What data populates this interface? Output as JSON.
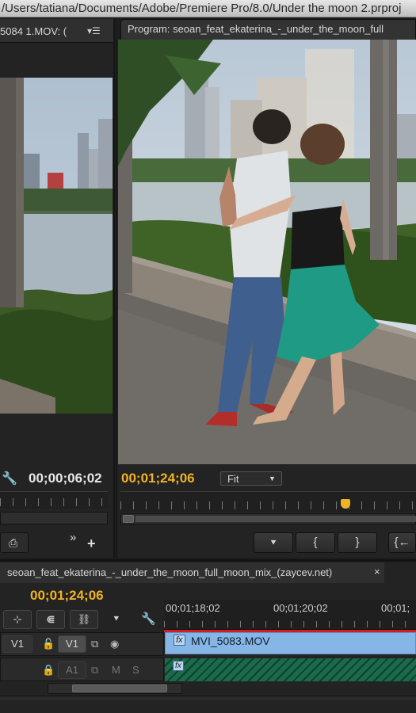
{
  "window": {
    "title": "/Users/tatiana/Documents/Adobe/Premiere Pro/8.0/Under the moon 2.prproj"
  },
  "source_monitor": {
    "tab_label": "5084 1.MOV: (",
    "menu_icon": "panel-menu-icon",
    "timecode": "00;00;06;02",
    "wrench_icon": "wrench-icon",
    "export_frame_icon": "export-frame-icon",
    "overflow_label": "»",
    "add_label": "+"
  },
  "program_monitor": {
    "tab_label": "Program: seoan_feat_ekaterina_-_under_the_moon_full",
    "timecode": "00;01;24;06",
    "fit_label": "Fit",
    "fit_arrow": "▼",
    "buttons": [
      {
        "name": "add-marker-button",
        "label": "⯆"
      },
      {
        "name": "mark-in-button",
        "label": "{"
      },
      {
        "name": "mark-out-button",
        "label": "}"
      },
      {
        "name": "go-to-in-button",
        "label": "{←"
      }
    ]
  },
  "timeline": {
    "sequence_tab": "seoan_feat_ekaterina_-_under_the_moon_full_moon_mix_(zaycev.net)",
    "close_label": "×",
    "timecode": "00;01;24;06",
    "ruler_labels": [
      "00;01;18;02",
      "00;01;20;02",
      "00;01;"
    ],
    "tracks": {
      "v1_source": "V1",
      "v1_target": "V1",
      "a1_target": "A1",
      "mute": "M",
      "solo": "S"
    },
    "clip_video": "MVI_5083.MOV",
    "clip_fx": "fx",
    "clip_audio_fx": "fx"
  },
  "colors": {
    "accent_timecode": "#f1b323",
    "video_clip": "#86b6e6",
    "audio_clip": "#1c6b4e",
    "playhead": "#d22"
  }
}
